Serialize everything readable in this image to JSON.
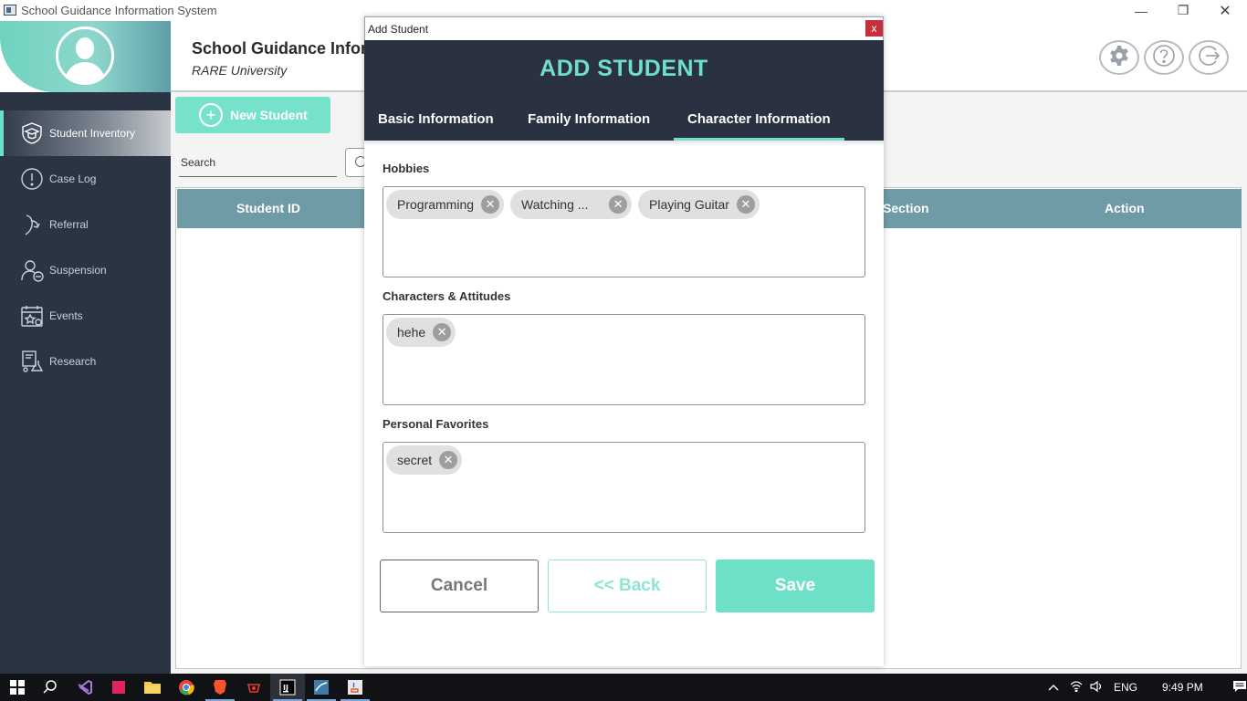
{
  "window": {
    "title": "School Guidance Information System",
    "min_glyph": "—",
    "max_glyph": "❐",
    "close_glyph": "✕"
  },
  "header": {
    "title": "School Guidance Information System",
    "subtitle": "RARE University"
  },
  "sidebar": {
    "items": [
      {
        "label": "Student Inventory",
        "icon": "graduation-shield-icon",
        "active": true
      },
      {
        "label": "Case Log",
        "icon": "alert-circle-icon"
      },
      {
        "label": "Referral",
        "icon": "referral-icon"
      },
      {
        "label": "Suspension",
        "icon": "user-minus-icon"
      },
      {
        "label": "Events",
        "icon": "calendar-star-icon"
      },
      {
        "label": "Research",
        "icon": "flask-icon"
      }
    ]
  },
  "toolbar": {
    "new_student_label": "New Student",
    "search_label": "Search"
  },
  "table": {
    "columns": [
      "Student ID",
      "Section",
      "Action"
    ]
  },
  "dialog": {
    "window_title": "Add Student",
    "close_glyph": "x",
    "title": "ADD STUDENT",
    "tabs": [
      {
        "label": "Basic Information",
        "active": false
      },
      {
        "label": "Family Information",
        "active": false
      },
      {
        "label": "Character Information",
        "active": true
      }
    ],
    "fields": [
      {
        "label": "Hobbies",
        "chips": [
          "Programming",
          "Watching ...",
          "Playing Guitar"
        ]
      },
      {
        "label": "Characters & Attitudes",
        "chips": [
          "hehe"
        ]
      },
      {
        "label": "Personal Favorites",
        "chips": [
          "secret"
        ]
      }
    ],
    "buttons": {
      "cancel": "Cancel",
      "back": "<< Back",
      "save": "Save"
    }
  },
  "taskbar": {
    "apps": [
      "windows-start",
      "search",
      "visual-studio",
      "app-red",
      "file-explorer",
      "chrome",
      "brave",
      "app-red-2",
      "intellij",
      "mysql-workbench",
      "java"
    ],
    "language": "ENG",
    "time": "9:49 PM"
  },
  "colors": {
    "accent": "#6fe0c8",
    "sidebar": "#2b3443",
    "dialog_header": "#2a3242",
    "table_header": "#6e9ba6"
  }
}
